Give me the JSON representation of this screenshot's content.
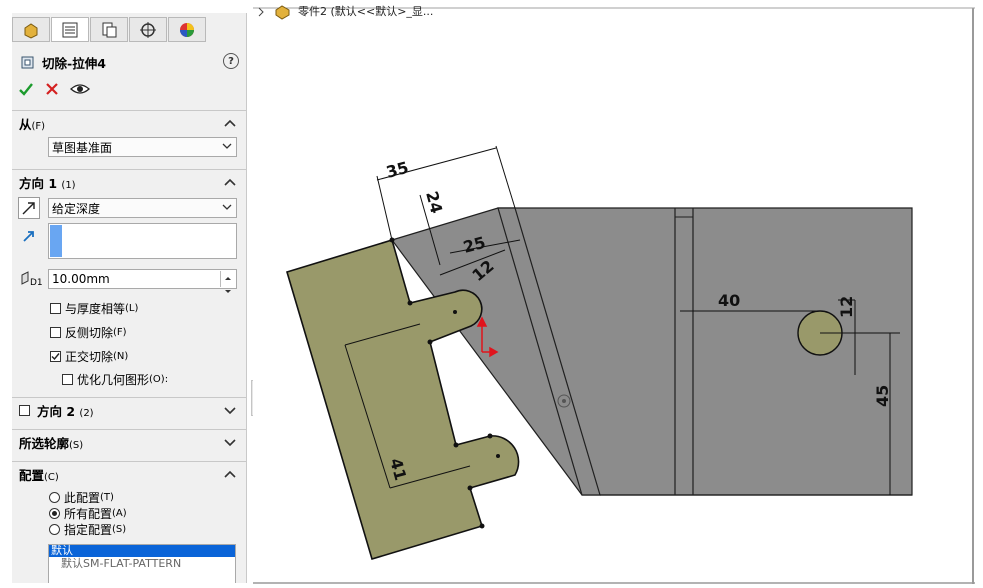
{
  "top_breadcrumb": "零件2 (默认<<默认>_显...",
  "feature": {
    "title": "切除-拉伸4"
  },
  "sections": {
    "from": {
      "label": "从",
      "key": "(F)",
      "value": "草图基准面"
    },
    "direction1": {
      "label": "方向 1",
      "key": "(1)",
      "end_condition": "给定深度",
      "depth": "10.00mm",
      "options": [
        {
          "label": "与厚度相等",
          "key": "(L)",
          "checked": false
        },
        {
          "label": "反侧切除",
          "key": "(F)",
          "checked": false
        },
        {
          "label": "正交切除",
          "key": "(N)",
          "checked": true
        }
      ],
      "sub_option": {
        "label": "优化几何图形",
        "key": "(O):",
        "checked": false
      }
    },
    "direction2": {
      "label": "方向 2",
      "key": "(2)",
      "checked": false
    },
    "selected_contours": {
      "label": "所选轮廓",
      "key": "(S)"
    },
    "config": {
      "label": "配置",
      "key": "(C)",
      "options": [
        {
          "label": "此配置",
          "key": "(T)",
          "selected": false
        },
        {
          "label": "所有配置",
          "key": "(A)",
          "selected": true
        },
        {
          "label": "指定配置",
          "key": "(S)",
          "selected": false
        }
      ],
      "list": [
        "默认",
        "默认SM-FLAT-PATTERN"
      ]
    }
  },
  "dimensions": {
    "d35": "35",
    "d24": "24",
    "d25": "25",
    "d12a": "12",
    "d40": "40",
    "d12b": "12",
    "d45": "45",
    "d41": "41"
  },
  "colors": {
    "part_gray": "#8c8c8c",
    "sketch_olive": "#99996a",
    "selection_blue": "#0a64d8"
  }
}
